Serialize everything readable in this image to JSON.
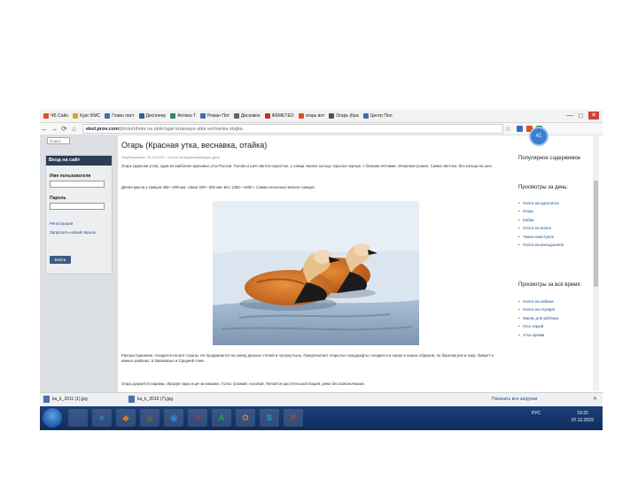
{
  "bookmarks": [
    {
      "label": "ЧБ Сайн",
      "color": "#d9531e"
    },
    {
      "label": "Курс БМС",
      "color": "#e0a12a"
    },
    {
      "label": "Главн лист",
      "color": "#3a6fb5"
    },
    {
      "label": "Дисплеер",
      "color": "#2b5f9e"
    },
    {
      "label": "Аптека-Т",
      "color": "#2e8b57"
    },
    {
      "label": "Роман Пот",
      "color": "#3a6fb5"
    },
    {
      "label": "Дисковое",
      "color": "#666666"
    },
    {
      "label": "ФЕМЕТЕО",
      "color": "#c03030"
    },
    {
      "label": "огарь вот",
      "color": "#d9531e"
    },
    {
      "label": "Огарь (Кра",
      "color": "#555555"
    },
    {
      "label": "Центр Пол",
      "color": "#3a6fb5"
    }
  ],
  "window": {
    "close_glyph": "✕",
    "min_glyph": "—",
    "max_glyph": "□"
  },
  "address": {
    "host": "ekol.prov.com",
    "path": "/photo/ohota na utok/ogar krasnaya utka vechanka otajka"
  },
  "avatar_text": "41",
  "left": {
    "search_placeholder": "Поиск",
    "login_title": "Вход на сайт",
    "username_label": "Имя пользователя",
    "password_label": "Пароль",
    "links": [
      "Регистрация",
      "Запросить новый пароль"
    ],
    "login_button": "Войти"
  },
  "main": {
    "title": "Огарь (Красная утка, веснавка, отайка)",
    "meta": "Опубликовано: 05.10.2011 · Охота на водоплавающую дичь",
    "para1": "Огарь (красная утка), одна из наиболее красивых уток России. Голова и шея светло-охристые, у самца черное кольцо. Крылья черные, с белыми пятнами. Оперение рыжее. Самка светлее, без кольца на шее.",
    "para2": "Длина крыла у самцов 355—390 мм, самок 330—360 мм. Вес 1250—1600 г. Самки несколько мельче самцов.",
    "para3": "Распространение: гнездится на юге страны. Не продвигается на север дальше степей и полупустынь. Предпочитает открытые ландшафты, гнездится в норах и нишах обрывов, по берегам рек и озер. Зимует в южных районах, в Закавказье и Средней Азии.",
    "para4": "Огарь держится парами, образуя пары ещё на зимовке. Голос громкий, носовой. Питается растительной пищей, реже беспозвоночными."
  },
  "right": {
    "popular_head": "Популярное содержимое",
    "today_head": "Просмотры за день:",
    "today_items": [
      "Охота на куропаток",
      "Огарь",
      "Кабан",
      "Охота на волка",
      "Чирок-свистунок",
      "Охота на вальдшнепа"
    ],
    "all_head": "Просмотры за всё время:",
    "all_items": [
      "Охота на кабана",
      "Охота на глухаря",
      "Манок для рябчика",
      "Гусь серый",
      "Утка кряква"
    ]
  },
  "downloads": {
    "file1": "ka_k_2011 (1).jpg",
    "file2": "ka_k_2016 (7).jpg",
    "show_all": "Показать все загрузки",
    "close_glyph": "✕"
  },
  "taskbar": {
    "icons": [
      {
        "name": "B",
        "color": "#1e5db8"
      },
      {
        "name": "e",
        "color": "#2a8ad8"
      },
      {
        "name": "◆",
        "color": "#e07a20"
      },
      {
        "name": "▣",
        "color": "#5a5a5a"
      },
      {
        "name": "◉",
        "color": "#3a7fd0"
      },
      {
        "name": "●",
        "color": "#c0302a"
      },
      {
        "name": "A",
        "color": "#2e9e44"
      },
      {
        "name": "O",
        "color": "#e88a1a"
      },
      {
        "name": "S",
        "color": "#1d9ee0"
      },
      {
        "name": "P",
        "color": "#c83e22"
      }
    ],
    "lang": "РУС",
    "time": "19:22",
    "date": "07.12.2015"
  }
}
